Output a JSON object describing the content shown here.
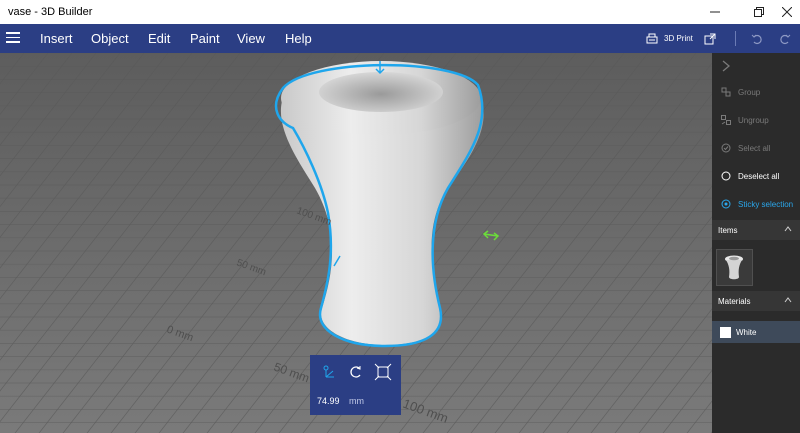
{
  "window": {
    "title": "vase - 3D Builder"
  },
  "menu": {
    "items": [
      "Insert",
      "Object",
      "Edit",
      "Paint",
      "View",
      "Help"
    ],
    "print_label": "3D Print"
  },
  "viewport": {
    "grid_labels": [
      "100 mm",
      "50 mm",
      "0 mm",
      "50 mm",
      "100 mm"
    ]
  },
  "panel": {
    "actions": [
      {
        "label": "Group",
        "enabled": false,
        "icon": "group-icon"
      },
      {
        "label": "Ungroup",
        "enabled": false,
        "icon": "ungroup-icon"
      },
      {
        "label": "Select all",
        "enabled": false,
        "icon": "select-all-icon"
      },
      {
        "label": "Deselect all",
        "enabled": true,
        "icon": "deselect-all-icon"
      },
      {
        "label": "Sticky selection",
        "enabled": true,
        "active": true,
        "icon": "sticky-selection-icon"
      }
    ],
    "items_header": "Items",
    "materials_header": "Materials",
    "material_name": "White"
  },
  "toolbox": {
    "value": "74.99",
    "unit": "mm"
  },
  "colors": {
    "accent": "#2b3e84",
    "selection": "#1fa6ec",
    "panel_bg": "#2b2b2b"
  }
}
